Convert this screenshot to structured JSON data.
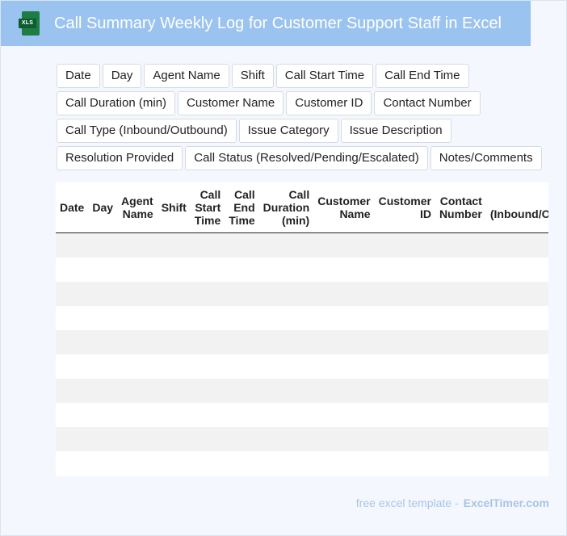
{
  "header": {
    "title": "Call Summary Weekly Log for Customer Support Staff in Excel",
    "icon_label": "XLS"
  },
  "tags": [
    "Date",
    "Day",
    "Agent Name",
    "Shift",
    "Call Start Time",
    "Call End Time",
    "Call Duration (min)",
    "Customer Name",
    "Customer ID",
    "Contact Number",
    "Call Type (Inbound/Outbound)",
    "Issue Category",
    "Issue Description",
    "Resolution Provided",
    "Call Status (Resolved/Pending/Escalated)",
    "Notes/Comments"
  ],
  "table": {
    "columns": [
      "Date",
      "Day",
      "Agent Name",
      "Shift",
      "Call Start Time",
      "Call End Time",
      "Call Duration (min)",
      "Customer Name",
      "Customer ID",
      "Contact Number",
      "Call Type (Inbound/Outbound)"
    ],
    "empty_rows": 10
  },
  "footer": {
    "prefix": "free excel template -",
    "brand": "ExcelTimer.com"
  }
}
